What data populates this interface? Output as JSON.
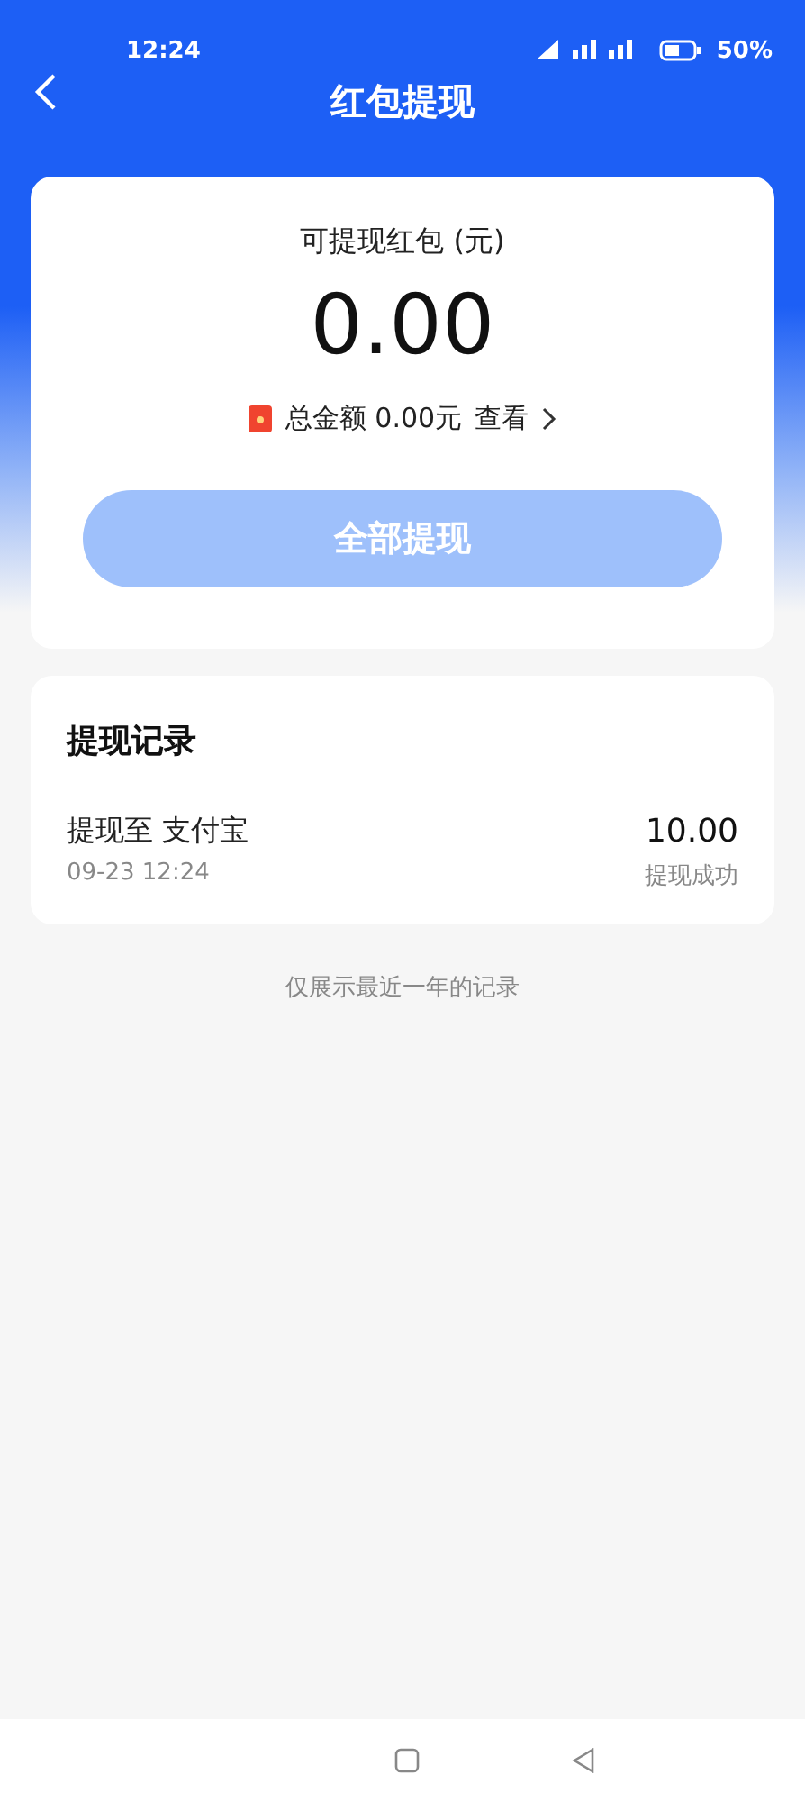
{
  "status_bar": {
    "time": "12:24",
    "battery": "50%"
  },
  "header": {
    "title": "红包提现"
  },
  "balance": {
    "label": "可提现红包 (元)",
    "amount": "0.00",
    "total_label": "总金额 0.00元",
    "view_link": "查看"
  },
  "withdraw_button": {
    "label": "全部提现",
    "disabled": true
  },
  "records": {
    "title": "提现记录",
    "items": [
      {
        "destination": "提现至 支付宝",
        "date": "09-23 12:24",
        "amount": "10.00",
        "status": "提现成功"
      }
    ]
  },
  "footer_note": "仅展示最近一年的记录"
}
